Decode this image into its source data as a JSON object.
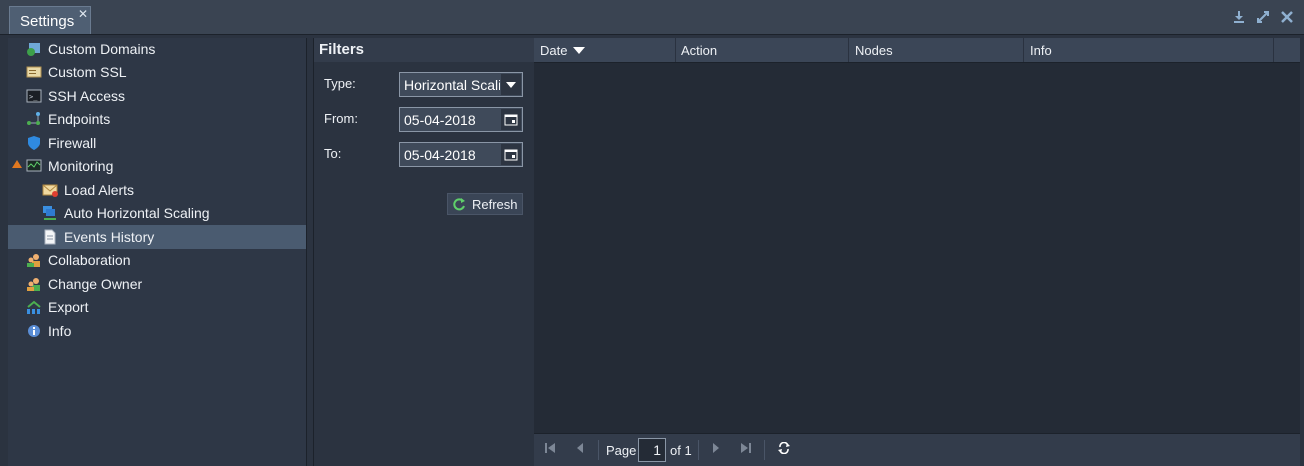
{
  "window": {
    "tab_label": "Settings",
    "close_glyph": "✕",
    "icons": [
      "download-icon",
      "maximize-icon",
      "close-icon"
    ]
  },
  "sidebar": {
    "items": [
      {
        "label": "Custom Domains",
        "icon": "domain-icon"
      },
      {
        "label": "Custom SSL",
        "icon": "ssl-certificate-icon"
      },
      {
        "label": "SSH Access",
        "icon": "terminal-icon"
      },
      {
        "label": "Endpoints",
        "icon": "endpoints-icon"
      },
      {
        "label": "Firewall",
        "icon": "shield-icon"
      },
      {
        "label": "Monitoring",
        "icon": "monitor-icon",
        "expanded": true
      },
      {
        "label": "Load Alerts",
        "icon": "envelope-alert-icon",
        "child": true
      },
      {
        "label": "Auto Horizontal Scaling",
        "icon": "scaling-icon",
        "child": true
      },
      {
        "label": "Events History",
        "icon": "document-icon",
        "child": true,
        "selected": true
      },
      {
        "label": "Collaboration",
        "icon": "users-icon"
      },
      {
        "label": "Change Owner",
        "icon": "change-owner-icon"
      },
      {
        "label": "Export",
        "icon": "export-icon"
      },
      {
        "label": "Info",
        "icon": "info-icon"
      }
    ]
  },
  "filters": {
    "title": "Filters",
    "type_label": "Type:",
    "type_value": "Horizontal Scaling",
    "from_label": "From:",
    "from_value": "05-04-2018",
    "to_label": "To:",
    "to_value": "05-04-2018",
    "refresh_label": "Refresh"
  },
  "grid": {
    "columns": [
      "Date",
      "Action",
      "Nodes",
      "Info"
    ],
    "sorted_column": "Date",
    "rows": []
  },
  "pager": {
    "page_label": "Page",
    "page_value": "1",
    "of_label": "of 1"
  },
  "colors": {
    "accent": "#4a5b70",
    "expander": "#e07820"
  }
}
